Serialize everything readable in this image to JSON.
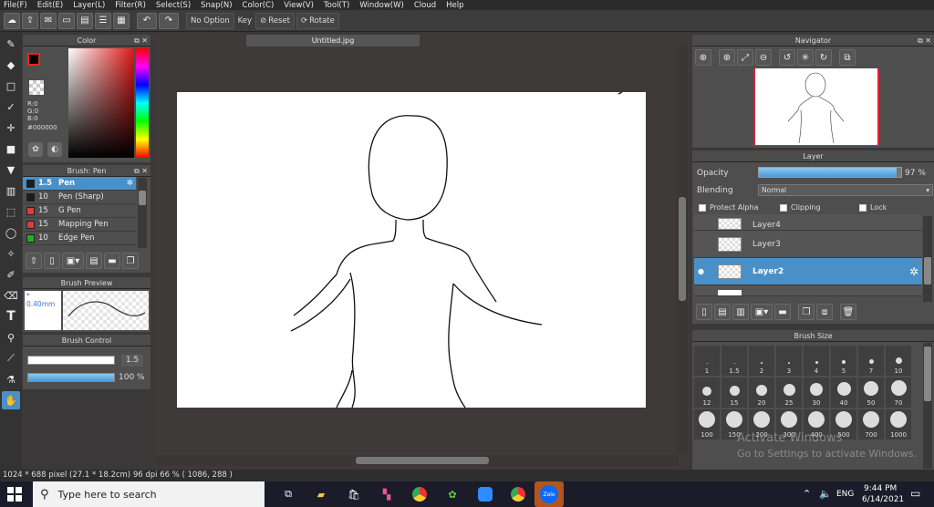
{
  "menu": [
    "File(F)",
    "Edit(E)",
    "Layer(L)",
    "Filter(R)",
    "Select(S)",
    "Snap(N)",
    "Color(C)",
    "View(V)",
    "Tool(T)",
    "Window(W)",
    "Cloud",
    "Help"
  ],
  "toolbar": {
    "no_option": "No Option",
    "key": "Key",
    "reset": "Reset",
    "rotate": "Rotate"
  },
  "color_panel": {
    "title": "Color",
    "r": "R:0",
    "g": "G:0",
    "b": "B:0",
    "hex": "#000000"
  },
  "brush_panel": {
    "title": "Brush: Pen",
    "items": [
      {
        "size": "1.5",
        "name": "Pen",
        "color": "#1c1c1c"
      },
      {
        "size": "10",
        "name": "Pen (Sharp)",
        "color": "#1c1c1c"
      },
      {
        "size": "15",
        "name": "G Pen",
        "color": "#e03a3a"
      },
      {
        "size": "15",
        "name": "Mapping Pen",
        "color": "#e03a3a"
      },
      {
        "size": "10",
        "name": "Edge Pen",
        "color": "#22b022"
      }
    ]
  },
  "brush_preview": {
    "title": "Brush Preview",
    "size": "* 0.40mm"
  },
  "brush_control": {
    "title": "Brush Control",
    "size_value": "1.5",
    "opacity_value": "100 %"
  },
  "document": {
    "tab": "Untitled.jpg"
  },
  "navigator": {
    "title": "Navigator"
  },
  "layer_panel": {
    "title": "Layer",
    "opacity_label": "Opacity",
    "opacity_value": "97 %",
    "opacity_level": 0.97,
    "blending_label": "Blending",
    "blending_value": "Normal",
    "protect_alpha": "Protect Alpha",
    "clipping": "Clipping",
    "lock": "Lock",
    "layers": [
      {
        "name": "Layer4"
      },
      {
        "name": "Layer3"
      },
      {
        "name": "Layer2"
      }
    ]
  },
  "brush_size": {
    "title": "Brush Size",
    "sizes": [
      "1",
      "1.5",
      "2",
      "3",
      "4",
      "5",
      "7",
      "10",
      "12",
      "15",
      "20",
      "25",
      "30",
      "40",
      "50",
      "70",
      "100",
      "150",
      "200",
      "300",
      "400",
      "500",
      "700",
      "1000"
    ]
  },
  "status": {
    "text": "1024 * 688 pixel   (27.1 * 18.2cm)   96 dpi   66 %   ( 1086, 288 )"
  },
  "watermark": {
    "line1": "Activate Windows",
    "line2": "Go to Settings to activate Windows."
  },
  "taskbar": {
    "search_placeholder": "Type here to search",
    "lang": "ENG",
    "time": "9:44 PM",
    "date": "6/14/2021",
    "zalo": "Zalo"
  }
}
